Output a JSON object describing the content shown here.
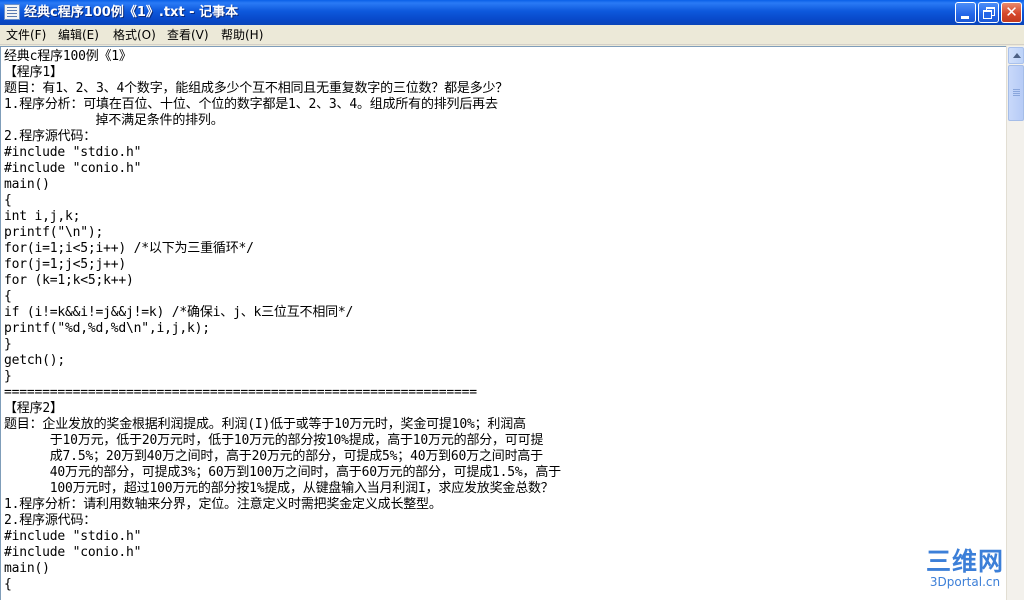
{
  "window": {
    "title": "经典c程序100例《1》.txt - 记事本"
  },
  "menu": {
    "items": [
      "文件(F)",
      "编辑(E)",
      "格式(O)",
      "查看(V)",
      "帮助(H)"
    ]
  },
  "editor": {
    "lines": [
      "经典c程序100例《1》",
      "【程序1】",
      "题目：有1、2、3、4个数字，能组成多少个互不相同且无重复数字的三位数？都是多少？",
      "1.程序分析：可填在百位、十位、个位的数字都是1、2、3、4。组成所有的排列后再去",
      "            掉不满足条件的排列。",
      "2.程序源代码：",
      "#include \"stdio.h\"",
      "#include \"conio.h\"",
      "main()",
      "{",
      "int i,j,k;",
      "printf(\"\\n\");",
      "for(i=1;i<5;i++) /*以下为三重循环*/",
      "for(j=1;j<5;j++)",
      "for (k=1;k<5;k++)",
      "{",
      "if (i!=k&&i!=j&&j!=k) /*确保i、j、k三位互不相同*/",
      "printf(\"%d,%d,%d\\n\",i,j,k);",
      "}",
      "getch();",
      "}",
      "==============================================================",
      "【程序2】",
      "题目：企业发放的奖金根据利润提成。利润(I)低于或等于10万元时，奖金可提10%；利润高",
      "      于10万元，低于20万元时，低于10万元的部分按10%提成，高于10万元的部分，可可提",
      "      成7.5%；20万到40万之间时，高于20万元的部分，可提成5%；40万到60万之间时高于",
      "      40万元的部分，可提成3%；60万到100万之间时，高于60万元的部分，可提成1.5%，高于",
      "      100万元时，超过100万元的部分按1%提成，从键盘输入当月利润I，求应发放奖金总数？",
      "1.程序分析：请利用数轴来分界，定位。注意定义时需把奖金定义成长整型。",
      "2.程序源代码：",
      "#include \"stdio.h\"",
      "#include \"conio.h\"",
      "main()",
      "{"
    ]
  },
  "watermark": {
    "logo_text": "三维网",
    "url_text": "3Dportal.cn"
  },
  "colors": {
    "titlebar": "#0a5fe8",
    "menubar": "#ece9d8",
    "editor_bg": "#ffffff",
    "watermark": "#3c7fd8"
  },
  "icons": {
    "app": "notepad-icon",
    "minimize": "minimize-icon",
    "maximize": "restore-icon",
    "close": "close-icon",
    "scroll_up": "arrow-up-icon"
  }
}
